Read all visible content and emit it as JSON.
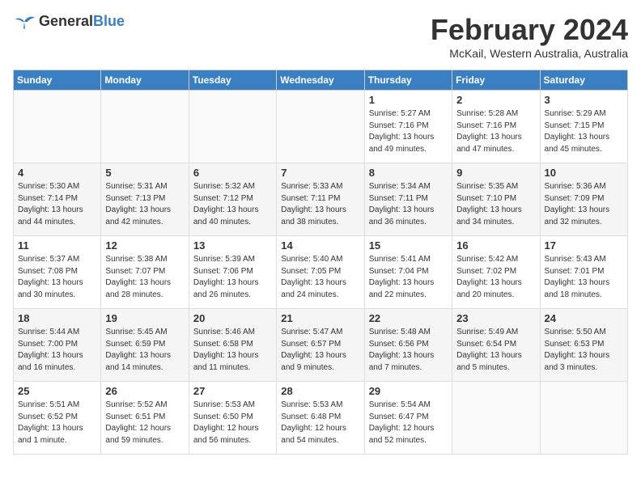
{
  "header": {
    "logo_general": "General",
    "logo_blue": "Blue",
    "month": "February 2024",
    "location": "McKail, Western Australia, Australia"
  },
  "days_of_week": [
    "Sunday",
    "Monday",
    "Tuesday",
    "Wednesday",
    "Thursday",
    "Friday",
    "Saturday"
  ],
  "weeks": [
    [
      {
        "day": "",
        "empty": true
      },
      {
        "day": "",
        "empty": true
      },
      {
        "day": "",
        "empty": true
      },
      {
        "day": "",
        "empty": true
      },
      {
        "day": "1",
        "sunrise": "5:27 AM",
        "sunset": "7:16 PM",
        "daylight": "13 hours and 49 minutes."
      },
      {
        "day": "2",
        "sunrise": "5:28 AM",
        "sunset": "7:16 PM",
        "daylight": "13 hours and 47 minutes."
      },
      {
        "day": "3",
        "sunrise": "5:29 AM",
        "sunset": "7:15 PM",
        "daylight": "13 hours and 45 minutes."
      }
    ],
    [
      {
        "day": "4",
        "sunrise": "5:30 AM",
        "sunset": "7:14 PM",
        "daylight": "13 hours and 44 minutes."
      },
      {
        "day": "5",
        "sunrise": "5:31 AM",
        "sunset": "7:13 PM",
        "daylight": "13 hours and 42 minutes."
      },
      {
        "day": "6",
        "sunrise": "5:32 AM",
        "sunset": "7:12 PM",
        "daylight": "13 hours and 40 minutes."
      },
      {
        "day": "7",
        "sunrise": "5:33 AM",
        "sunset": "7:11 PM",
        "daylight": "13 hours and 38 minutes."
      },
      {
        "day": "8",
        "sunrise": "5:34 AM",
        "sunset": "7:11 PM",
        "daylight": "13 hours and 36 minutes."
      },
      {
        "day": "9",
        "sunrise": "5:35 AM",
        "sunset": "7:10 PM",
        "daylight": "13 hours and 34 minutes."
      },
      {
        "day": "10",
        "sunrise": "5:36 AM",
        "sunset": "7:09 PM",
        "daylight": "13 hours and 32 minutes."
      }
    ],
    [
      {
        "day": "11",
        "sunrise": "5:37 AM",
        "sunset": "7:08 PM",
        "daylight": "13 hours and 30 minutes."
      },
      {
        "day": "12",
        "sunrise": "5:38 AM",
        "sunset": "7:07 PM",
        "daylight": "13 hours and 28 minutes."
      },
      {
        "day": "13",
        "sunrise": "5:39 AM",
        "sunset": "7:06 PM",
        "daylight": "13 hours and 26 minutes."
      },
      {
        "day": "14",
        "sunrise": "5:40 AM",
        "sunset": "7:05 PM",
        "daylight": "13 hours and 24 minutes."
      },
      {
        "day": "15",
        "sunrise": "5:41 AM",
        "sunset": "7:04 PM",
        "daylight": "13 hours and 22 minutes."
      },
      {
        "day": "16",
        "sunrise": "5:42 AM",
        "sunset": "7:02 PM",
        "daylight": "13 hours and 20 minutes."
      },
      {
        "day": "17",
        "sunrise": "5:43 AM",
        "sunset": "7:01 PM",
        "daylight": "13 hours and 18 minutes."
      }
    ],
    [
      {
        "day": "18",
        "sunrise": "5:44 AM",
        "sunset": "7:00 PM",
        "daylight": "13 hours and 16 minutes."
      },
      {
        "day": "19",
        "sunrise": "5:45 AM",
        "sunset": "6:59 PM",
        "daylight": "13 hours and 14 minutes."
      },
      {
        "day": "20",
        "sunrise": "5:46 AM",
        "sunset": "6:58 PM",
        "daylight": "13 hours and 11 minutes."
      },
      {
        "day": "21",
        "sunrise": "5:47 AM",
        "sunset": "6:57 PM",
        "daylight": "13 hours and 9 minutes."
      },
      {
        "day": "22",
        "sunrise": "5:48 AM",
        "sunset": "6:56 PM",
        "daylight": "13 hours and 7 minutes."
      },
      {
        "day": "23",
        "sunrise": "5:49 AM",
        "sunset": "6:54 PM",
        "daylight": "13 hours and 5 minutes."
      },
      {
        "day": "24",
        "sunrise": "5:50 AM",
        "sunset": "6:53 PM",
        "daylight": "13 hours and 3 minutes."
      }
    ],
    [
      {
        "day": "25",
        "sunrise": "5:51 AM",
        "sunset": "6:52 PM",
        "daylight": "13 hours and 1 minute."
      },
      {
        "day": "26",
        "sunrise": "5:52 AM",
        "sunset": "6:51 PM",
        "daylight": "12 hours and 59 minutes."
      },
      {
        "day": "27",
        "sunrise": "5:53 AM",
        "sunset": "6:50 PM",
        "daylight": "12 hours and 56 minutes."
      },
      {
        "day": "28",
        "sunrise": "5:53 AM",
        "sunset": "6:48 PM",
        "daylight": "12 hours and 54 minutes."
      },
      {
        "day": "29",
        "sunrise": "5:54 AM",
        "sunset": "6:47 PM",
        "daylight": "12 hours and 52 minutes."
      },
      {
        "day": "",
        "empty": true
      },
      {
        "day": "",
        "empty": true
      }
    ]
  ]
}
